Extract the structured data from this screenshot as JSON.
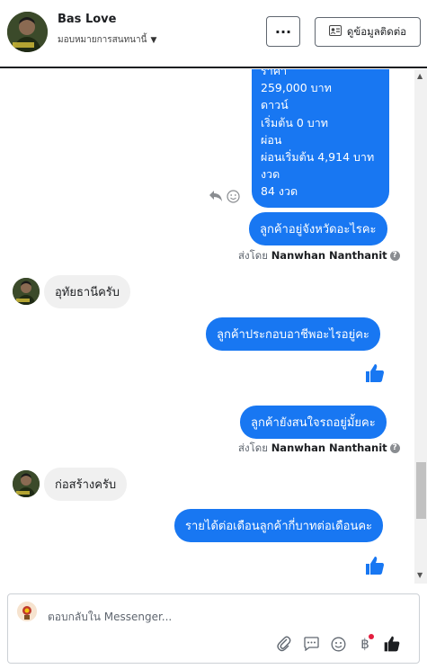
{
  "header": {
    "name": "Bas Love",
    "assign_label": "มอบหมายการสนทนานี้",
    "more_label": "···",
    "contact_label": "ดูข้อมูลติดต่อ"
  },
  "messages": {
    "price_block": [
      "ราคา",
      "259,000 บาท",
      "ดาวน์",
      "เริ่มต้น 0 บาท",
      "ผ่อน",
      "ผ่อนเริ่มต้น 4,914 บาท",
      "งวด",
      "84 งวด"
    ],
    "out_1": "ลูกค้าอยู่จังหวัดอะไรคะ",
    "sent_by_prefix": "ส่งโดย",
    "sent_by_name": "Nanwhan Nanthanit",
    "in_1": "อุทัยธานีครับ",
    "out_2": "ลูกค้าประกอบอาชีพอะไรอยู่คะ",
    "out_3": "ลูกค้ายังสนใจรถอยู่มั้ยคะ",
    "in_2": "ก่อสร้างครับ",
    "out_4": "รายได้ต่อเดือนลูกค้ากี่บาทต่อเดือนคะ"
  },
  "composer": {
    "placeholder": "ตอบกลับใน Messenger..."
  },
  "colors": {
    "accent": "#1877f2",
    "incoming_bubble": "#f0f0f0"
  }
}
